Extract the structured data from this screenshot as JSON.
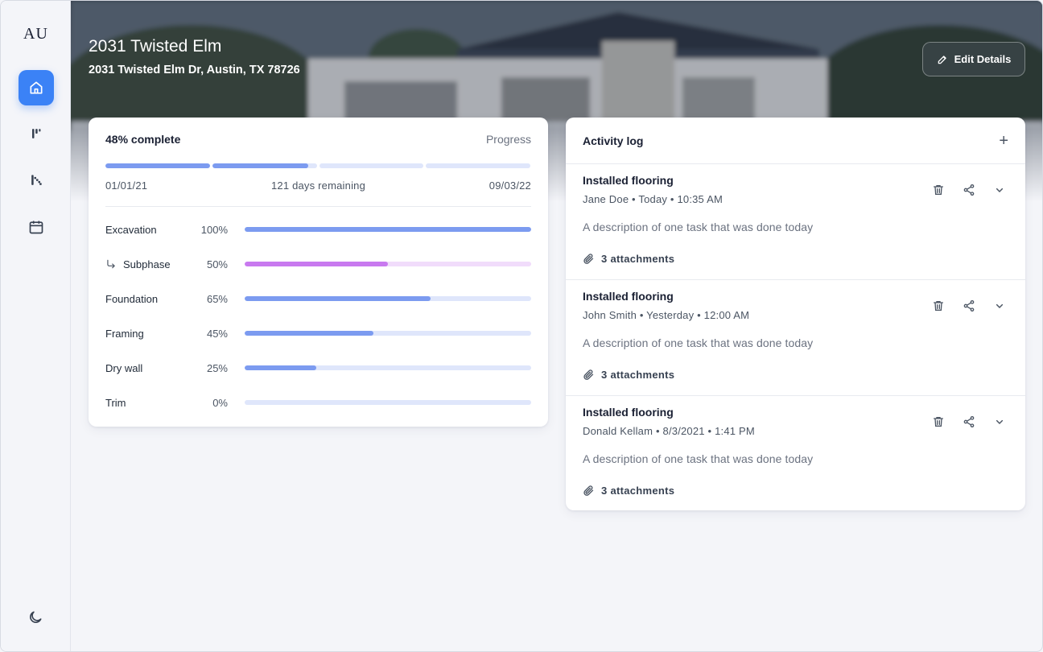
{
  "sidebar": {
    "logo": "AU",
    "nav": [
      {
        "icon": "home-icon",
        "active": true
      },
      {
        "icon": "tools-icon",
        "active": false
      },
      {
        "icon": "stairs-icon",
        "active": false
      },
      {
        "icon": "calendar-icon",
        "active": false
      }
    ],
    "bottom_icon": "moon-icon"
  },
  "header": {
    "title": "2031 Twisted Elm",
    "address": "2031 Twisted Elm Dr, Austin, TX 78726",
    "edit_label": "Edit Details"
  },
  "progress": {
    "complete_label": "48% complete",
    "section_label": "Progress",
    "overall_fraction": 0.48,
    "start_date": "01/01/21",
    "remaining": "121 days remaining",
    "end_date": "09/03/22",
    "phases": [
      {
        "name": "Excavation",
        "percent_label": "100%",
        "value": 100,
        "sub": false
      },
      {
        "name": "Subphase",
        "percent_label": "50%",
        "value": 50,
        "sub": true
      },
      {
        "name": "Foundation",
        "percent_label": "65%",
        "value": 65,
        "sub": false
      },
      {
        "name": "Framing",
        "percent_label": "45%",
        "value": 45,
        "sub": false
      },
      {
        "name": "Dry wall",
        "percent_label": "25%",
        "value": 25,
        "sub": false
      },
      {
        "name": "Trim",
        "percent_label": "0%",
        "value": 0,
        "sub": false
      }
    ]
  },
  "activity": {
    "title": "Activity log",
    "add_symbol": "+",
    "items": [
      {
        "title": "Installed flooring",
        "meta": "Jane Doe • Today • 10:35 AM",
        "description": "A description of one task that was done today",
        "attachments": "3 attachments"
      },
      {
        "title": "Installed flooring",
        "meta": "John Smith • Yesterday • 12:00 AM",
        "description": "A description of one task that was done today",
        "attachments": "3 attachments"
      },
      {
        "title": "Installed flooring",
        "meta": "Donald Kellam • 8/3/2021 • 1:41 PM",
        "description": "A description of one task that was done today",
        "attachments": "3 attachments"
      }
    ]
  },
  "colors": {
    "accent": "#3b82f6",
    "bar": "#7c9bf0",
    "bar_track": "#dfe6fb",
    "sub_bar": "#c879ef",
    "sub_track": "#f1dcfb"
  }
}
